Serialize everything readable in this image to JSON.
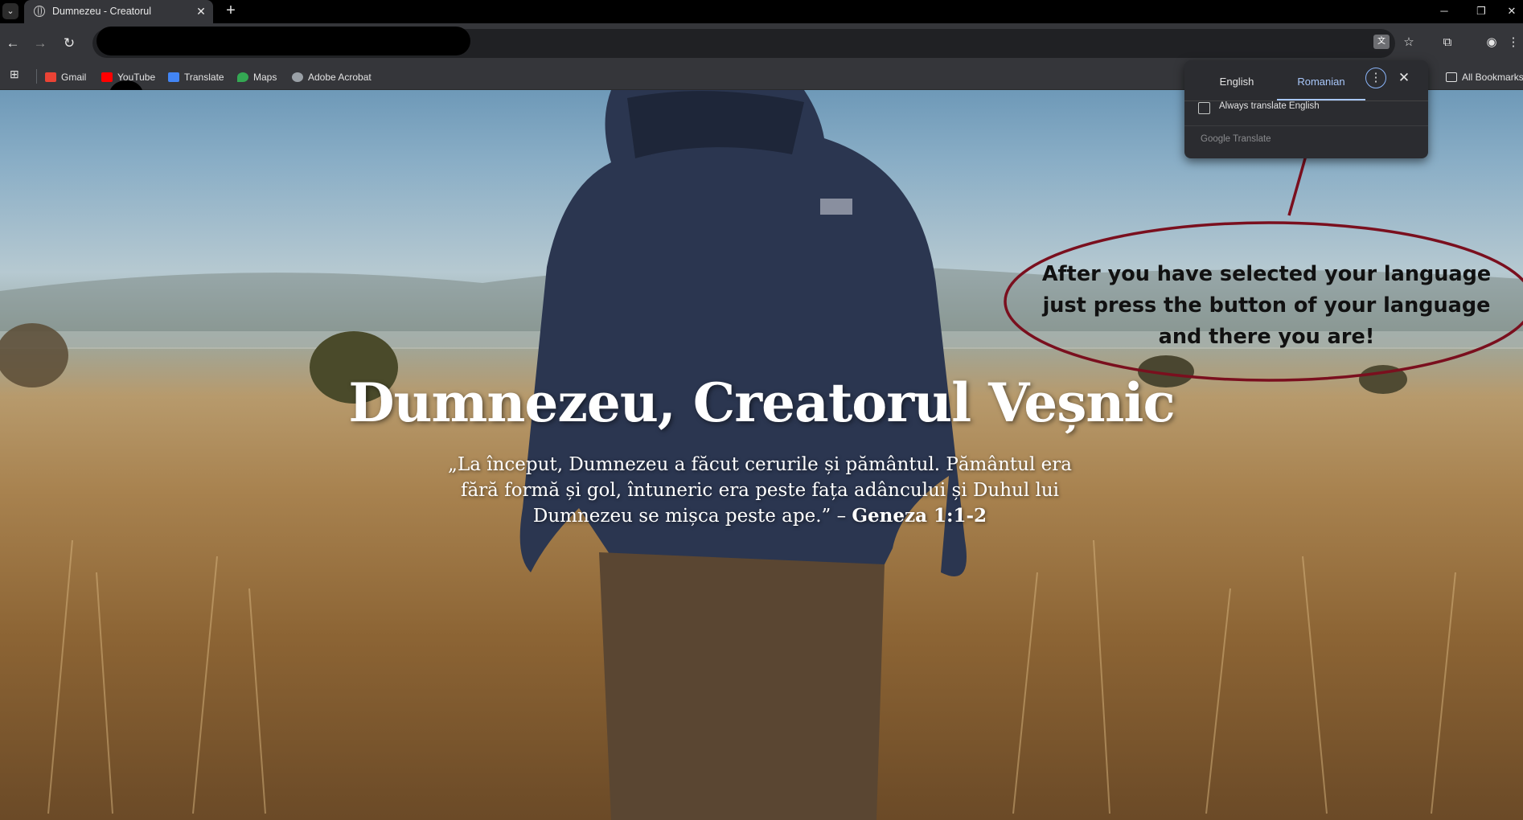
{
  "browser": {
    "tab": {
      "title": "Dumnezeu - Creatorul",
      "close_glyph": "✕"
    },
    "new_tab_glyph": "+",
    "tab_search_glyph": "⌄",
    "window_controls": {
      "minimize": "─",
      "restore": "❐",
      "close": "✕"
    },
    "nav": {
      "back": "←",
      "forward": "→",
      "reload": "↻"
    },
    "toolbar_icons": {
      "translate": "文",
      "star": "☆",
      "extensions": "⧉",
      "profile": "◉",
      "menu": "⋮"
    }
  },
  "bookmarks": {
    "apps_glyph": "⊞",
    "items": [
      {
        "label": "Gmail",
        "icon": "gmail-icon",
        "color": "#ea4335"
      },
      {
        "label": "YouTube",
        "icon": "youtube-icon",
        "color": "#ff0000"
      },
      {
        "label": "Translate",
        "icon": "translate-icon",
        "color": "#4285f4"
      },
      {
        "label": "Maps",
        "icon": "maps-icon",
        "color": "#34a853"
      },
      {
        "label": "Adobe Acrobat",
        "icon": "globe-icon",
        "color": "#9aa0a6"
      }
    ],
    "all_bookmarks": "All Bookmarks"
  },
  "translate_popup": {
    "source_language": "English",
    "target_language": "Romanian",
    "more_glyph": "⋮",
    "close_glyph": "✕",
    "always_translate_label": "Always translate English",
    "footer": "Google Translate",
    "accent": "#a8c7fa"
  },
  "page": {
    "title": "Dumnezeu, Creatorul Veșnic",
    "quote": "„La început, Dumnezeu a făcut cerurile și pământul. Pământul era fără formă și gol, întuneric era peste fața adâncului și Duhul lui Dumnezeu se mișca peste ape.” –",
    "quote_reference": "Geneza 1:1-2"
  },
  "annotation": {
    "lines": [
      "After you have selected your language",
      "just press the button of your language",
      "and there you are!"
    ],
    "color": "#7a0f1e"
  }
}
